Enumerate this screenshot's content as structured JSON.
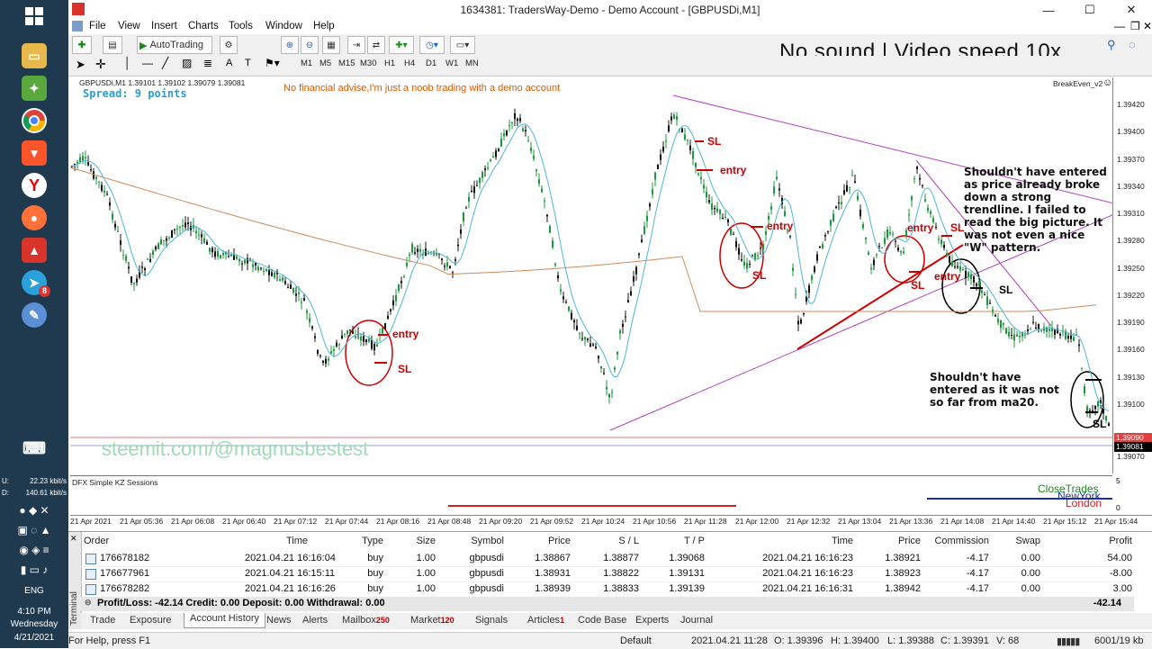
{
  "taskbar": {
    "network_up": "22.23 kbit/s",
    "network_down": "140.61 kbit/s",
    "network_up_label": "U:",
    "network_down_label": "D:",
    "language": "ENG",
    "time": "4:10 PM",
    "day": "Wednesday",
    "date": "4/21/2021",
    "telegram_badge": "8"
  },
  "window": {
    "title": "1634381: TradersWay-Demo - Demo Account - [GBPUSDi,M1]"
  },
  "menu": [
    "File",
    "View",
    "Insert",
    "Charts",
    "Tools",
    "Window",
    "Help"
  ],
  "toolbar": {
    "autotrading_label": "AutoTrading",
    "timeframes": [
      "M1",
      "M5",
      "M15",
      "M30",
      "H1",
      "H4",
      "D1",
      "W1",
      "MN"
    ]
  },
  "video_overlay": "No sound | Video speed 10x",
  "chart": {
    "symbol_info": "GBPUSDi,M1  1.39101 1.39102 1.39079 1.39081",
    "spread": "Spread: 9 points",
    "disclaimer": "No financial advise,I'm just a noob trading with a demo account",
    "ea_name": "BreakEven_v2",
    "watermark": "steemit.com/@magnusbestest",
    "notes": {
      "note1": [
        "Shouldn't have entered",
        "as price already broke",
        "down a strong",
        "trendline. I failed to",
        "read the big picture. It",
        "was not even a nice",
        "\"W\" pattern."
      ],
      "note2": [
        "Shouldn't have",
        "entered as it was not",
        "so far from ma20."
      ]
    },
    "labels": {
      "entry": "entry",
      "sl": "SL"
    },
    "price_labels": [
      "1.39420",
      "1.39400",
      "1.39370",
      "1.39340",
      "1.39310",
      "1.39280",
      "1.39250",
      "1.39220",
      "1.39190",
      "1.39160",
      "1.39130",
      "1.39100",
      "1.39070"
    ],
    "current_bid": "1.39090",
    "current_price": "1.39081",
    "time_labels": [
      "21 Apr 2021",
      "21 Apr 05:36",
      "21 Apr 06:08",
      "21 Apr 06:40",
      "21 Apr 07:12",
      "21 Apr 07:44",
      "21 Apr 08:16",
      "21 Apr 08:48",
      "21 Apr 09:20",
      "21 Apr 09:52",
      "21 Apr 10:24",
      "21 Apr 10:56",
      "21 Apr 11:28",
      "21 Apr 12:00",
      "21 Apr 12:32",
      "21 Apr 13:04",
      "21 Apr 13:36",
      "21 Apr 14:08",
      "21 Apr 14:40",
      "21 Apr 15:12",
      "21 Apr 15:44"
    ]
  },
  "indicator": {
    "name": "DFX Simple KZ Sessions",
    "close_trades": "CloseTrades",
    "newyork": "NewYork",
    "london": "London",
    "scale_top": "5",
    "scale_bottom": "0"
  },
  "terminal": {
    "title": "Terminal",
    "headers": [
      "Order",
      "Time",
      "Type",
      "Size",
      "Symbol",
      "Price",
      "S / L",
      "T / P",
      "Time",
      "Price",
      "Commission",
      "Swap",
      "Profit"
    ],
    "rows": [
      [
        "176678182",
        "2021.04.21 16:16:04",
        "buy",
        "1.00",
        "gbpusdi",
        "1.38867",
        "1.38877",
        "1.39068",
        "2021.04.21 16:16:23",
        "1.38921",
        "-4.17",
        "0.00",
        "54.00"
      ],
      [
        "176677961",
        "2021.04.21 16:15:11",
        "buy",
        "1.00",
        "gbpusdi",
        "1.38931",
        "1.38822",
        "1.39131",
        "2021.04.21 16:16:23",
        "1.38923",
        "-4.17",
        "0.00",
        "-8.00"
      ],
      [
        "176678282",
        "2021.04.21 16:16:26",
        "buy",
        "1.00",
        "gbpusdi",
        "1.38939",
        "1.38833",
        "1.39139",
        "2021.04.21 16:16:31",
        "1.38942",
        "-4.17",
        "0.00",
        "3.00"
      ]
    ],
    "summary": "Profit/Loss: -42.14  Credit: 0.00  Deposit: 0.00  Withdrawal: 0.00",
    "summary_total": "-42.14",
    "tabs": [
      {
        "label": "Trade",
        "badge": ""
      },
      {
        "label": "Exposure",
        "badge": ""
      },
      {
        "label": "Account History",
        "badge": ""
      },
      {
        "label": "News",
        "badge": ""
      },
      {
        "label": "Alerts",
        "badge": ""
      },
      {
        "label": "Mailbox",
        "badge": "250"
      },
      {
        "label": "Market",
        "badge": "120"
      },
      {
        "label": "Signals",
        "badge": ""
      },
      {
        "label": "Articles",
        "badge": "1"
      },
      {
        "label": "Code Base",
        "badge": ""
      },
      {
        "label": "Experts",
        "badge": ""
      },
      {
        "label": "Journal",
        "badge": ""
      }
    ]
  },
  "status": {
    "help": "For Help, press F1",
    "profile": "Default",
    "datetime": "2021.04.21 11:28",
    "open": "O: 1.39396",
    "high": "H: 1.39400",
    "low": "L: 1.39388",
    "close": "C: 1.39391",
    "volume": "V: 68",
    "traffic": "6001/19 kb"
  },
  "colors": {
    "accent_red": "#cc0000",
    "ma_fast": "#4fb6d6",
    "ma_slow": "#d08a5a",
    "trendline": "#b040c0",
    "taskbar": "#1f3a4f"
  }
}
